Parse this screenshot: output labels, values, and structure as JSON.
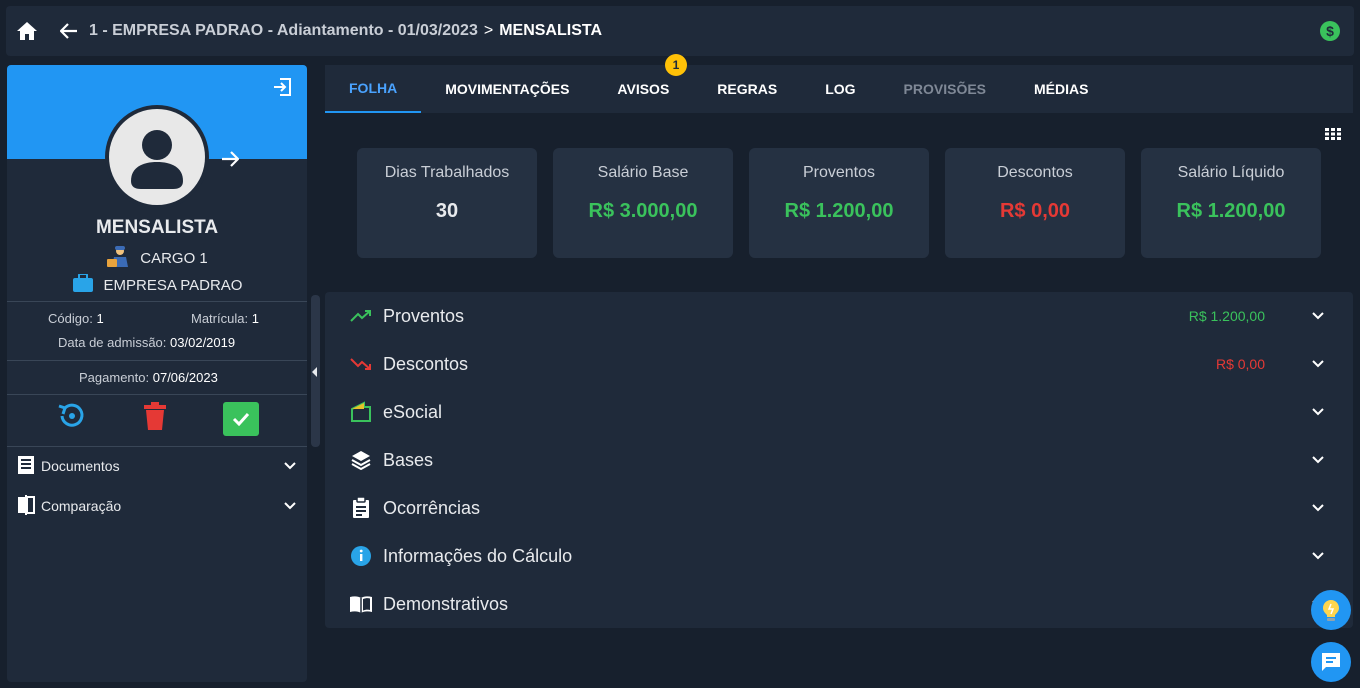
{
  "header": {
    "home_icon": "home-icon",
    "back_icon": "arrow-left-icon",
    "breadcrumb_main": "1 - EMPRESA PADRAO - Adiantamento - 01/03/2023",
    "breadcrumb_separator": ">",
    "breadcrumb_current": "MENSALISTA",
    "money_icon_symbol": "$"
  },
  "sidebar": {
    "name": "MENSALISTA",
    "cargo": "CARGO 1",
    "company": "EMPRESA PADRAO",
    "codigo_label": "Código:",
    "codigo_value": "1",
    "matricula_label": "Matrícula:",
    "matricula_value": "1",
    "admissao_label": "Data de admissão:",
    "admissao_value": "03/02/2019",
    "pagamento_label": "Pagamento:",
    "pagamento_value": "07/06/2023",
    "menu": [
      {
        "label": "Documentos",
        "icon": "document-list-icon"
      },
      {
        "label": "Comparação",
        "icon": "compare-icon"
      }
    ],
    "accent": "#2196f3"
  },
  "tabs": [
    {
      "label": "FOLHA",
      "state": "active"
    },
    {
      "label": "MOVIMENTAÇÕES",
      "state": "normal"
    },
    {
      "label": "AVISOS",
      "state": "normal"
    },
    {
      "label": "REGRAS",
      "state": "normal"
    },
    {
      "label": "LOG",
      "state": "normal"
    },
    {
      "label": "PROVISÕES",
      "state": "disabled"
    },
    {
      "label": "MÉDIAS",
      "state": "normal"
    }
  ],
  "avisos_badge": "1",
  "cards": [
    {
      "title": "Dias Trabalhados",
      "value": "30",
      "color": "white"
    },
    {
      "title": "Salário Base",
      "value": "R$ 3.000,00",
      "color": "green"
    },
    {
      "title": "Proventos",
      "value": "R$ 1.200,00",
      "color": "green"
    },
    {
      "title": "Descontos",
      "value": "R$ 0,00",
      "color": "red"
    },
    {
      "title": "Salário Líquido",
      "value": "R$ 1.200,00",
      "color": "green"
    }
  ],
  "sections": [
    {
      "label": "Proventos",
      "value": "R$ 1.200,00",
      "value_color": "green",
      "icon": "trending-up-icon"
    },
    {
      "label": "Descontos",
      "value": "R$ 0,00",
      "value_color": "red",
      "icon": "trending-down-icon"
    },
    {
      "label": "eSocial",
      "value": "",
      "icon": "esocial-icon"
    },
    {
      "label": "Bases",
      "value": "",
      "icon": "layers-icon"
    },
    {
      "label": "Ocorrências",
      "value": "",
      "icon": "clipboard-icon"
    },
    {
      "label": "Informações do Cálculo",
      "value": "",
      "icon": "info-icon"
    },
    {
      "label": "Demonstrativos",
      "value": "",
      "icon": "book-icon"
    }
  ],
  "colors": {
    "green": "#3ac25c",
    "red": "#e53935",
    "badge": "#ffc107",
    "panel": "#1f2a3a",
    "background": "#17202d"
  }
}
